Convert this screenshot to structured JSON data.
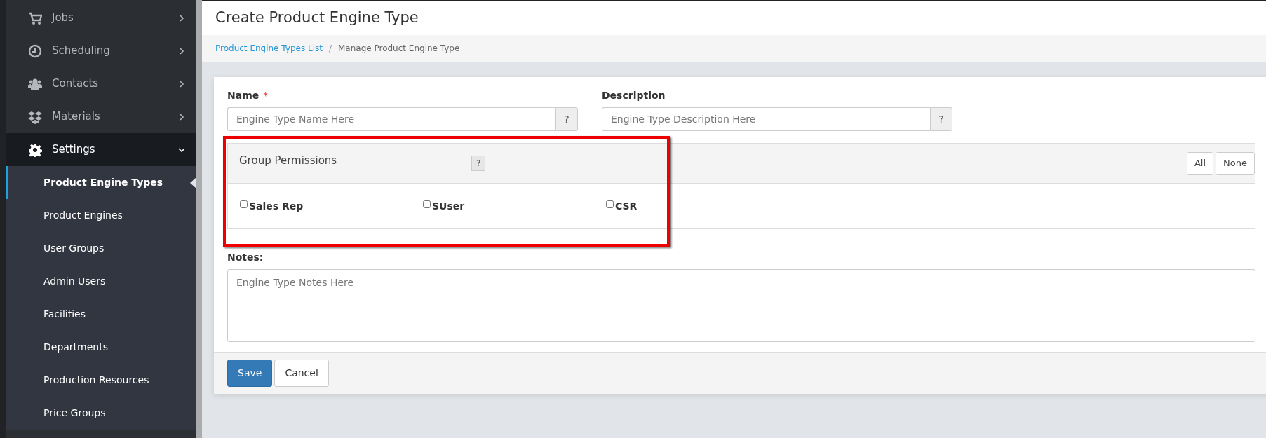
{
  "sidebar": {
    "items": [
      {
        "label": "Jobs",
        "expanded": false,
        "selected": false
      },
      {
        "label": "Scheduling",
        "expanded": false,
        "selected": false
      },
      {
        "label": "Contacts",
        "expanded": false,
        "selected": false
      },
      {
        "label": "Materials",
        "expanded": false,
        "selected": false
      },
      {
        "label": "Settings",
        "expanded": true,
        "selected": true,
        "children": [
          {
            "label": "Product Engine Types",
            "selected": true
          },
          {
            "label": "Product Engines",
            "selected": false
          },
          {
            "label": "User Groups",
            "selected": false
          },
          {
            "label": "Admin Users",
            "selected": false
          },
          {
            "label": "Facilities",
            "selected": false
          },
          {
            "label": "Departments",
            "selected": false
          },
          {
            "label": "Production Resources",
            "selected": false
          },
          {
            "label": "Price Groups",
            "selected": false
          }
        ]
      }
    ]
  },
  "page_title": "Create Product Engine Type",
  "breadcrumb_separator": "/",
  "breadcrumb": [
    {
      "label": "Product Engine Types List",
      "link": true
    },
    {
      "label": "Manage Product Engine Type",
      "link": false
    }
  ],
  "form": {
    "fields": [
      {
        "label": "Name",
        "required": true,
        "placeholder": "Engine Type Name Here",
        "help": "?"
      },
      {
        "label": "Description",
        "required": false,
        "placeholder": "Engine Type Description Here",
        "help": "?"
      }
    ],
    "required_mark": "*",
    "group_permissions": {
      "title": "Group Permissions",
      "help": "?",
      "buttons": [
        "All",
        "None"
      ],
      "groups": [
        {
          "label": "Sales Rep",
          "checked": false
        },
        {
          "label": "SUser",
          "checked": false
        },
        {
          "label": "CSR",
          "checked": false
        }
      ],
      "highlighted": true
    },
    "notes": {
      "label": "Notes:",
      "placeholder": "Engine Type Notes Here"
    },
    "buttons": [
      {
        "label": "Save",
        "kind": "primary"
      },
      {
        "label": "Cancel",
        "kind": "secondary"
      }
    ]
  }
}
